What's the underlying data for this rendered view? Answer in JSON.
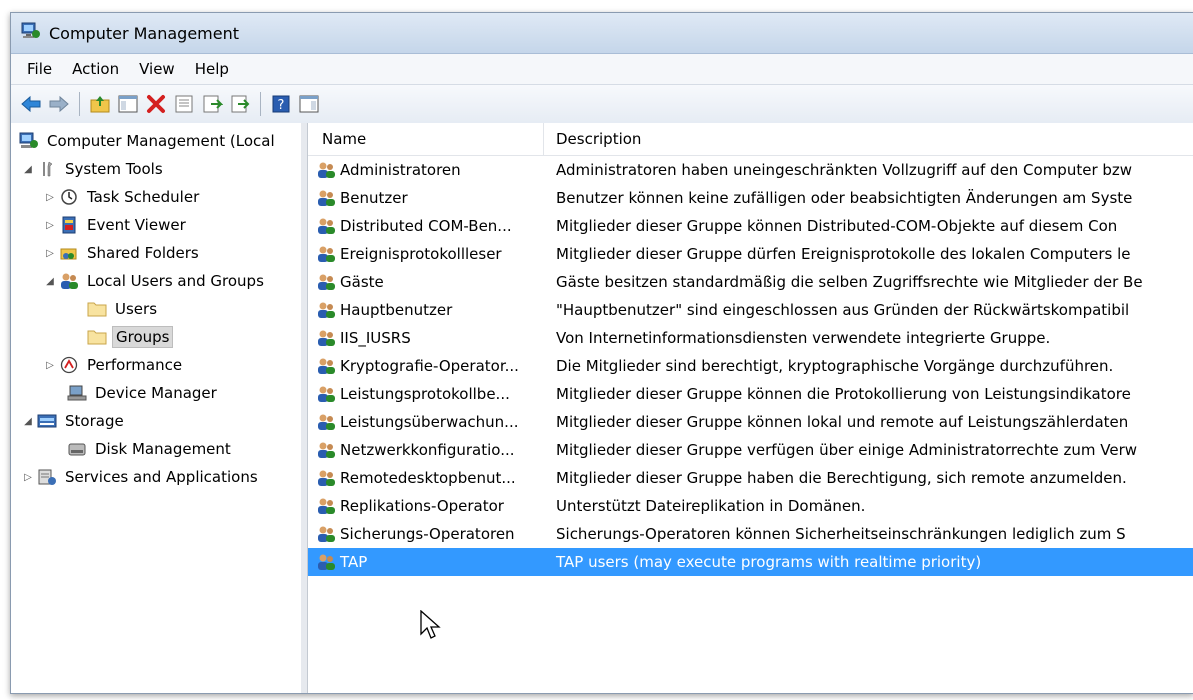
{
  "window": {
    "title": "Computer Management"
  },
  "menu": [
    "File",
    "Action",
    "View",
    "Help"
  ],
  "toolbar": {
    "icons": [
      "back-arrow-icon",
      "forward-arrow-icon",
      "up-folder-icon",
      "show-hide-tree-icon",
      "delete-icon",
      "properties-icon",
      "refresh-icon",
      "export-list-icon",
      "help-icon",
      "show-hide-action-pane-icon"
    ]
  },
  "tree": {
    "root": "Computer Management (Local",
    "system_tools": "System Tools",
    "task_scheduler": "Task Scheduler",
    "event_viewer": "Event Viewer",
    "shared_folders": "Shared Folders",
    "local_users_groups": "Local Users and Groups",
    "users": "Users",
    "groups": "Groups",
    "performance": "Performance",
    "device_manager": "Device Manager",
    "storage": "Storage",
    "disk_management": "Disk Management",
    "services_apps": "Services and Applications"
  },
  "list": {
    "columns": {
      "name": "Name",
      "description": "Description"
    },
    "rows": [
      {
        "name": "Administratoren",
        "description": "Administratoren haben uneingeschränkten Vollzugriff auf den Computer bzw"
      },
      {
        "name": "Benutzer",
        "description": "Benutzer können keine zufälligen oder beabsichtigten Änderungen am Syste"
      },
      {
        "name": "Distributed COM-Ben...",
        "description": "Mitglieder dieser Gruppe können Distributed-COM-Objekte auf diesem Con"
      },
      {
        "name": "Ereignisprotokollleser",
        "description": "Mitglieder dieser Gruppe dürfen Ereignisprotokolle des lokalen Computers le"
      },
      {
        "name": "Gäste",
        "description": "Gäste besitzen standardmäßig die selben Zugriffsrechte wie Mitglieder der Be"
      },
      {
        "name": "Hauptbenutzer",
        "description": "\"Hauptbenutzer\" sind eingeschlossen aus Gründen der Rückwärtskompatibil"
      },
      {
        "name": "IIS_IUSRS",
        "description": "Von Internetinformationsdiensten verwendete integrierte Gruppe."
      },
      {
        "name": "Kryptografie-Operator...",
        "description": "Die Mitglieder sind berechtigt, kryptographische Vorgänge durchzuführen."
      },
      {
        "name": "Leistungsprotokollbe...",
        "description": "Mitglieder dieser Gruppe können die Protokollierung von Leistungsindikatore"
      },
      {
        "name": "Leistungsüberwachun...",
        "description": "Mitglieder dieser Gruppe können lokal und remote auf Leistungszählerdaten"
      },
      {
        "name": "Netzwerkkonfiguratio...",
        "description": "Mitglieder dieser Gruppe verfügen über einige Administratorrechte zum Verw"
      },
      {
        "name": "Remotedesktopbenut...",
        "description": "Mitglieder dieser Gruppe haben die Berechtigung, sich remote anzumelden."
      },
      {
        "name": "Replikations-Operator",
        "description": "Unterstützt Dateireplikation in Domänen."
      },
      {
        "name": "Sicherungs-Operatoren",
        "description": "Sicherungs-Operatoren können Sicherheitseinschränkungen lediglich zum S"
      },
      {
        "name": "TAP",
        "description": "TAP users (may execute programs with realtime priority)"
      }
    ]
  },
  "colors": {
    "selection": "#3399ff",
    "tree_selection": "#d9d9d9"
  }
}
